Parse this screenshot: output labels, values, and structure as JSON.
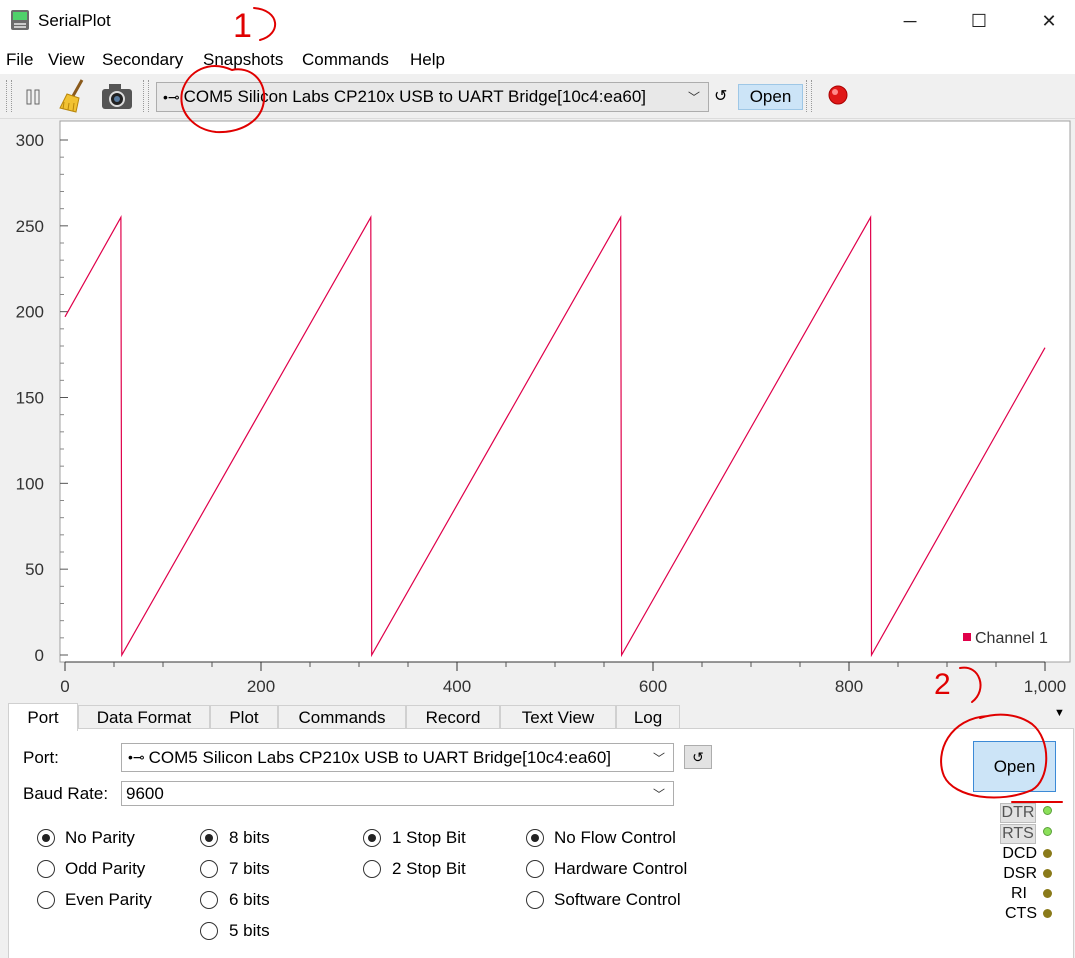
{
  "window": {
    "title": "SerialPlot",
    "controls": [
      "─",
      "☐",
      "✕"
    ]
  },
  "menu": [
    "File",
    "View",
    "Secondary",
    "Snapshots",
    "Commands",
    "Help"
  ],
  "toolbar": {
    "port_value": "COM5 Silicon Labs CP210x USB to UART Bridge[10c4:ea60]",
    "refresh_glyph": "↺",
    "open_label": "Open"
  },
  "chart_data": {
    "type": "line",
    "series": [
      {
        "name": "Channel 1",
        "color": "#e0004a",
        "points": [
          [
            0,
            197
          ],
          [
            57,
            255
          ],
          [
            58,
            0
          ],
          [
            312,
            255
          ],
          [
            313,
            0
          ],
          [
            567,
            255
          ],
          [
            568,
            0
          ],
          [
            822,
            255
          ],
          [
            823,
            0
          ],
          [
            1000,
            179
          ]
        ]
      }
    ],
    "xlim": [
      0,
      1000
    ],
    "ylim": [
      0,
      300
    ],
    "x_ticks": [
      "0",
      "200",
      "400",
      "600",
      "800",
      "1,000"
    ],
    "y_ticks": [
      "0",
      "50",
      "100",
      "150",
      "200",
      "250",
      "300"
    ],
    "legend_position": "bottom-right"
  },
  "tabs": [
    "Port",
    "Data Format",
    "Plot",
    "Commands",
    "Record",
    "Text View",
    "Log"
  ],
  "tab_menu_glyph": "▼",
  "port_panel": {
    "port_label": "Port:",
    "port_value": "COM5 Silicon Labs CP210x USB to UART Bridge[10c4:ea60]",
    "baud_label": "Baud Rate:",
    "baud_value": "9600",
    "refresh_glyph": "↺",
    "open_label": "Open",
    "parity": [
      {
        "label": "No Parity",
        "checked": true
      },
      {
        "label": "Odd Parity",
        "checked": false
      },
      {
        "label": "Even Parity",
        "checked": false
      }
    ],
    "bits": [
      {
        "label": "8 bits",
        "checked": true
      },
      {
        "label": "7 bits",
        "checked": false
      },
      {
        "label": "6 bits",
        "checked": false
      },
      {
        "label": "5 bits",
        "checked": false
      }
    ],
    "stop": [
      {
        "label": "1 Stop Bit",
        "checked": true
      },
      {
        "label": "2 Stop Bit",
        "checked": false
      }
    ],
    "flow": [
      {
        "label": "No Flow Control",
        "checked": true
      },
      {
        "label": "Hardware Control",
        "checked": false
      },
      {
        "label": "Software Control",
        "checked": false
      }
    ],
    "signals": [
      {
        "label": "DTR",
        "button": true,
        "on": true
      },
      {
        "label": "RTS",
        "button": true,
        "on": true
      },
      {
        "label": "DCD",
        "button": false,
        "on": false
      },
      {
        "label": "DSR",
        "button": false,
        "on": false
      },
      {
        "label": "RI",
        "button": false,
        "on": false
      },
      {
        "label": "CTS",
        "button": false,
        "on": false
      }
    ]
  },
  "annotations": {
    "mark_1": "1",
    "mark_2": "2"
  }
}
